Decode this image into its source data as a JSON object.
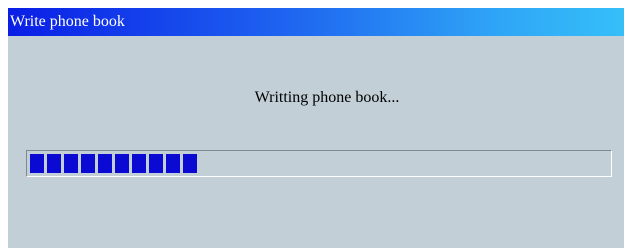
{
  "window": {
    "title": "Write phone book"
  },
  "message": "Writting phone book...",
  "progress": {
    "filled_blocks": 10,
    "fraction": 0.33,
    "block_color": "#0a0ad2"
  },
  "colors": {
    "titlebar_start": "#0a1ee6",
    "titlebar_end": "#35bff8",
    "dialog_background": "#c2cfd7"
  }
}
